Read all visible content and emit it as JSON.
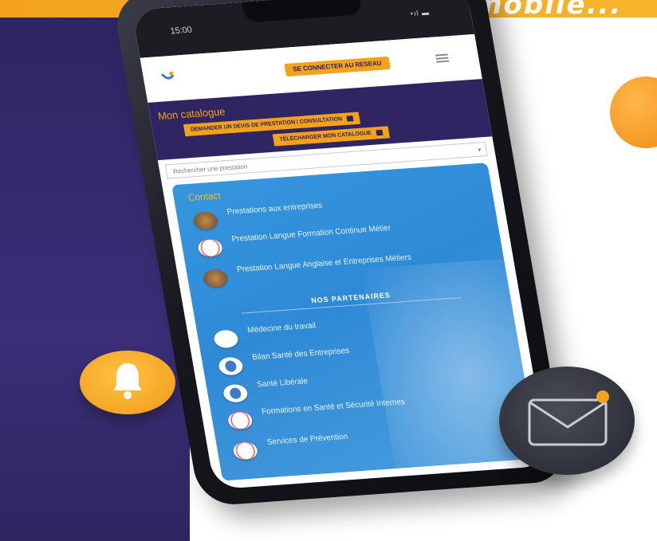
{
  "banner": {
    "text": "...application mobile..."
  },
  "status_bar": {
    "time": "15:00",
    "signal": "•ıl ▬"
  },
  "app_bar": {
    "connect_button": "SE CONNECTER AU RESEAU"
  },
  "catalog": {
    "title": "Mon catalogue",
    "buttons": [
      {
        "label": "DEMANDER UN DEVIS DE PRESTATION / CONSULTATION"
      },
      {
        "label": "TÉLÉCHARGER MON CATALOGUE"
      }
    ]
  },
  "search": {
    "placeholder": "Rechercher une prestation"
  },
  "panel": {
    "section_title": "Contact",
    "contacts": [
      {
        "label": "Prestations aux entreprises"
      },
      {
        "label": "Prestation Langue Formation Continue Métier"
      },
      {
        "label": "Prestation Langue Anglaise et Entreprises Métiers"
      }
    ],
    "partners_title": "NOS PARTENAIRES",
    "partners": [
      {
        "label": "Médecine du travail"
      },
      {
        "label": "Bilan Santé des Entreprises"
      },
      {
        "label": "Santé Libérale"
      },
      {
        "label": "Formations en Santé et Sécurité Internes"
      },
      {
        "label": "Services de Prévention"
      }
    ]
  },
  "icons": {
    "bell": "bell-icon",
    "mail": "envelope-icon",
    "notification_dot": "notification-dot-icon"
  },
  "colors": {
    "accent_orange": "#f4a21c",
    "brand_purple": "#2f2563",
    "panel_blue": "#3596dd"
  }
}
